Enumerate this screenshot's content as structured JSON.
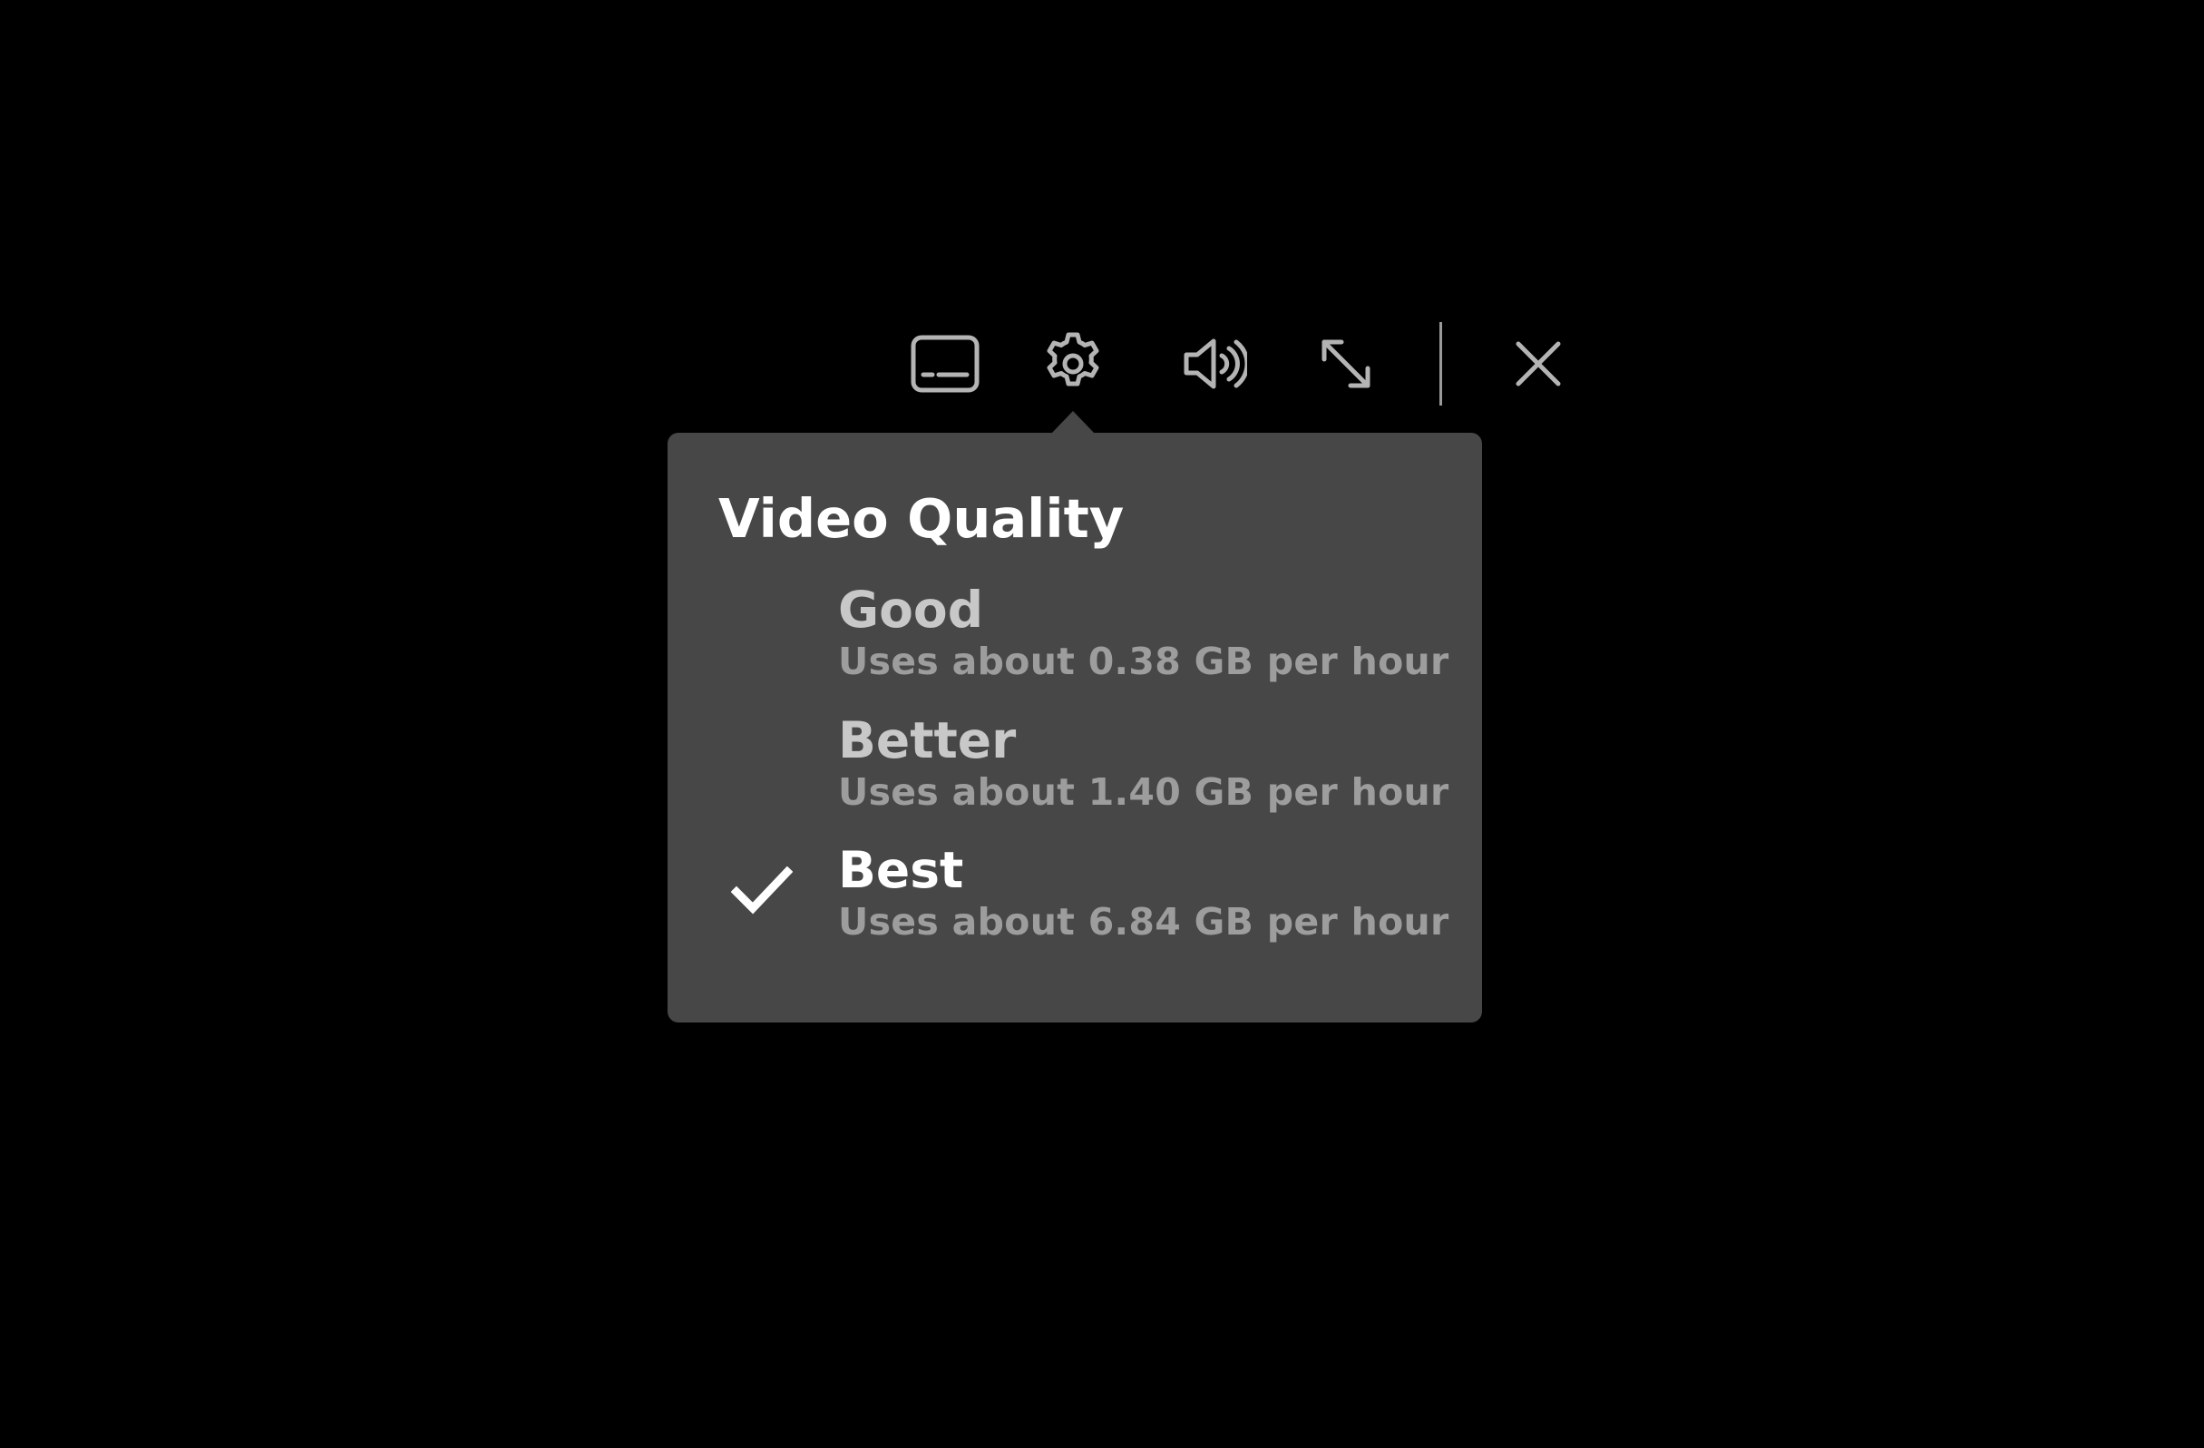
{
  "panel": {
    "title": "Video Quality",
    "options": [
      {
        "label": "Good",
        "description": "Uses about 0.38 GB per hour",
        "selected": false
      },
      {
        "label": "Better",
        "description": "Uses about 1.40 GB per hour",
        "selected": false
      },
      {
        "label": "Best",
        "description": "Uses about 6.84 GB per hour",
        "selected": true
      }
    ]
  },
  "toolbar": {
    "buttons": [
      {
        "icon": "subtitles-icon"
      },
      {
        "icon": "gear-icon",
        "active": true
      },
      {
        "icon": "volume-icon"
      },
      {
        "icon": "fullscreen-icon"
      },
      {
        "icon": "close-icon"
      }
    ]
  },
  "colors": {
    "background": "#000000",
    "panel": "#474747",
    "title": "#ffffff",
    "option_unselected": "#c8c8c8",
    "option_selected": "#ffffff",
    "description": "#9d9d9d",
    "icon": "#b4b4b4"
  }
}
